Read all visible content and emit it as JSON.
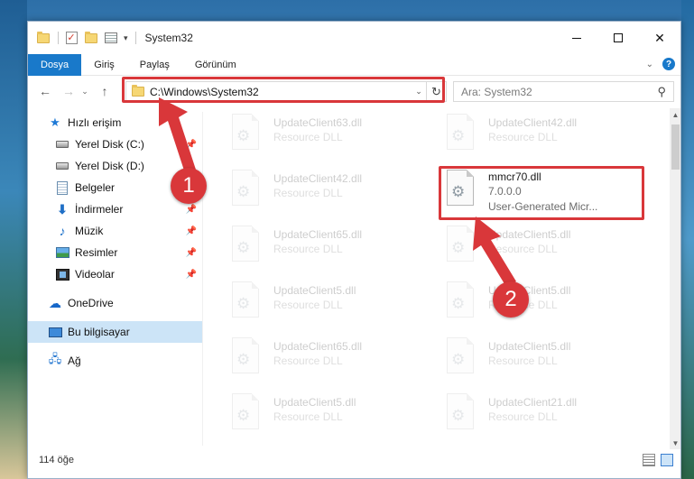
{
  "window": {
    "title": "System32",
    "controls": {
      "minimize": "minimize-icon",
      "maximize": "maximize-icon",
      "close": "✕"
    }
  },
  "ribbon": {
    "tabs": [
      {
        "label": "Dosya",
        "active": true
      },
      {
        "label": "Giriş"
      },
      {
        "label": "Paylaş"
      },
      {
        "label": "Görünüm"
      }
    ],
    "help": "?"
  },
  "nav": {
    "address": "C:\\Windows\\System32",
    "search_placeholder": "Ara: System32"
  },
  "sidebar": {
    "items": [
      {
        "label": "Hızlı erişim",
        "icon": "star-icon"
      },
      {
        "label": "Yerel Disk (C:)",
        "icon": "disk-icon",
        "pinned": true
      },
      {
        "label": "Yerel Disk (D:)",
        "icon": "disk-icon"
      },
      {
        "label": "Belgeler",
        "icon": "document-icon",
        "pinned": true
      },
      {
        "label": "İndirmeler",
        "icon": "download-icon",
        "pinned": true
      },
      {
        "label": "Müzik",
        "icon": "music-icon",
        "pinned": true
      },
      {
        "label": "Resimler",
        "icon": "pictures-icon",
        "pinned": true
      },
      {
        "label": "Videolar",
        "icon": "video-icon",
        "pinned": true
      },
      {
        "label": "OneDrive",
        "icon": "cloud-icon"
      },
      {
        "label": "Bu bilgisayar",
        "icon": "computer-icon",
        "selected": true
      },
      {
        "label": "Ağ",
        "icon": "network-icon"
      }
    ]
  },
  "files": [
    {
      "name": "UpdateClient63.dll",
      "desc": "Resource DLL",
      "faded": true
    },
    {
      "name": "UpdateClient42.dll",
      "desc": "Resource DLL",
      "faded": true
    },
    {
      "name": "UpdateClient42.dll",
      "desc": "Resource DLL",
      "faded": true
    },
    {
      "name": "mmcr70.dll",
      "version": "7.0.0.0",
      "desc": "User-Generated Micr...",
      "highlighted": true
    },
    {
      "name": "UpdateClient65.dll",
      "desc": "Resource DLL",
      "faded": true
    },
    {
      "name": "UpdateClient5.dll",
      "desc": "Resource DLL",
      "faded": true
    },
    {
      "name": "UpdateClient5.dll",
      "desc": "Resource DLL",
      "faded": true
    },
    {
      "name": "UpdateClient5.dll",
      "desc": "Resource DLL",
      "faded": true
    },
    {
      "name": "UpdateClient65.dll",
      "desc": "Resource DLL",
      "faded": true
    },
    {
      "name": "UpdateClient5.dll",
      "desc": "Resource DLL",
      "faded": true
    },
    {
      "name": "UpdateClient5.dll",
      "desc": "Resource DLL",
      "faded": true
    },
    {
      "name": "UpdateClient21.dll",
      "desc": "Resource DLL",
      "faded": true
    }
  ],
  "status": {
    "item_count": "114 öğe"
  },
  "annotations": {
    "callout_1": "1",
    "callout_2": "2",
    "color": "#d9373a"
  },
  "colors": {
    "accent": "#1979ca",
    "selection": "#cce4f7"
  }
}
